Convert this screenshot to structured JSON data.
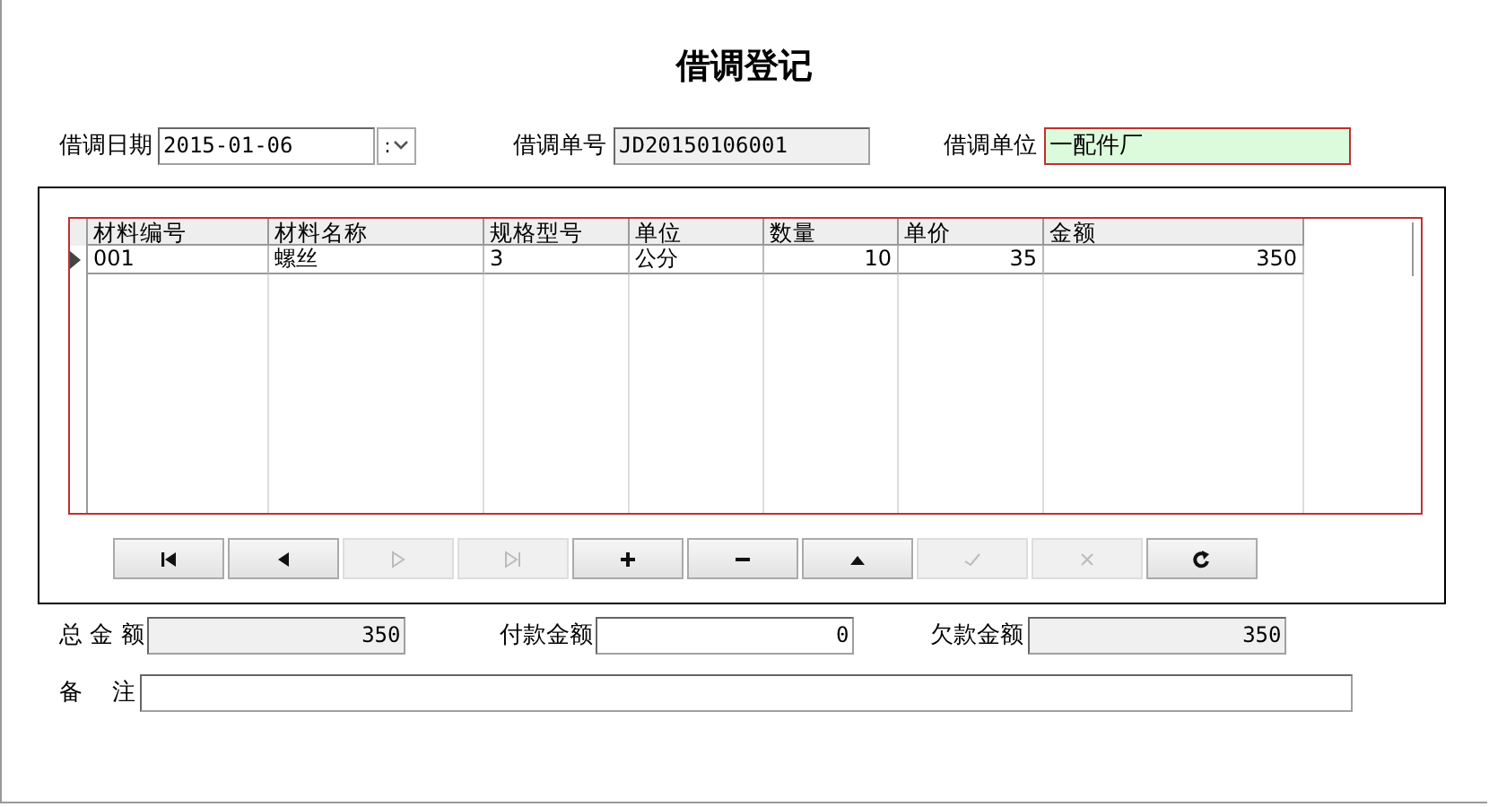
{
  "title": "借调登记",
  "header": {
    "date": {
      "label": "借调日期",
      "value": "2015-01-06",
      "separator": ":"
    },
    "number": {
      "label": "借调单号",
      "value": "JD20150106001",
      "readonly": true
    },
    "unit": {
      "label": "借调单位",
      "value": "一配件厂",
      "highlighted": true
    }
  },
  "grid": {
    "columns": [
      {
        "label": "材料编号",
        "numeric": false
      },
      {
        "label": "材料名称",
        "numeric": false
      },
      {
        "label": "规格型号",
        "numeric": false
      },
      {
        "label": "单位",
        "numeric": false
      },
      {
        "label": "数量",
        "numeric": true
      },
      {
        "label": "单价",
        "numeric": true
      },
      {
        "label": "金额",
        "numeric": true
      }
    ],
    "rows": [
      {
        "selected": true,
        "cells": [
          "001",
          "螺丝",
          "3",
          "公分",
          "10",
          "35",
          "350"
        ]
      }
    ]
  },
  "navigator": [
    {
      "kind": "first",
      "disabled": false
    },
    {
      "kind": "prior",
      "disabled": false
    },
    {
      "kind": "next",
      "disabled": true
    },
    {
      "kind": "last",
      "disabled": true
    },
    {
      "kind": "insert",
      "disabled": false
    },
    {
      "kind": "delete",
      "disabled": false
    },
    {
      "kind": "edit",
      "disabled": false
    },
    {
      "kind": "post",
      "disabled": true
    },
    {
      "kind": "cancel",
      "disabled": true
    },
    {
      "kind": "refresh",
      "disabled": false
    }
  ],
  "totals": [
    {
      "label": "总 金 额",
      "value": "350",
      "readonly": true
    },
    {
      "label": "付款金额",
      "value": "0",
      "readonly": false
    },
    {
      "label": "欠款金额",
      "value": "350",
      "readonly": true
    }
  ],
  "remark": {
    "label": "备    注"
  }
}
